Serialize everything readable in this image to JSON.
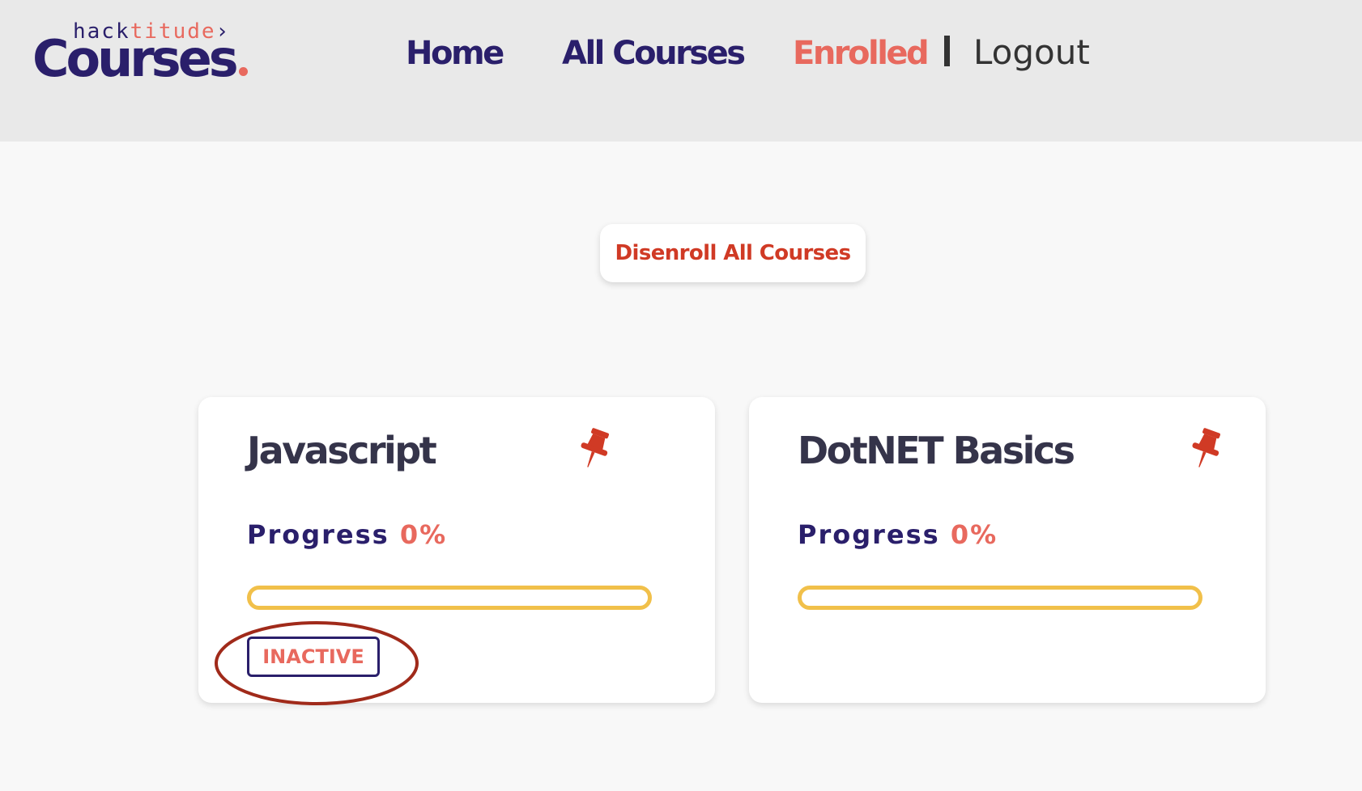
{
  "colors": {
    "brand_navy": "#2a1f6b",
    "accent_coral": "#e8695e",
    "danger_red": "#d03a25",
    "progress_yellow": "#f1c04a",
    "header_bg": "#e9e9e9",
    "page_bg": "#f8f8f8",
    "annotation_ring": "#a02a1a"
  },
  "logo": {
    "top_text_part1": "hack",
    "top_text_part2": "titude",
    "top_text_arrow": "›",
    "main_text": "Courses"
  },
  "nav": {
    "home": "Home",
    "all_courses": "All Courses",
    "enrolled": "Enrolled",
    "separator": "|",
    "logout": "Logout",
    "active": "Enrolled"
  },
  "actions": {
    "disenroll_all": "Disenroll All Courses"
  },
  "courses": [
    {
      "title": "Javascript",
      "progress_label": "Progress",
      "progress_text": "0%",
      "progress_value": 0,
      "status": "INACTIVE",
      "pin_icon": "pushpin-icon",
      "highlighted": true
    },
    {
      "title": "DotNET Basics",
      "progress_label": "Progress",
      "progress_text": "0%",
      "progress_value": 0,
      "pin_icon": "pushpin-icon"
    }
  ]
}
